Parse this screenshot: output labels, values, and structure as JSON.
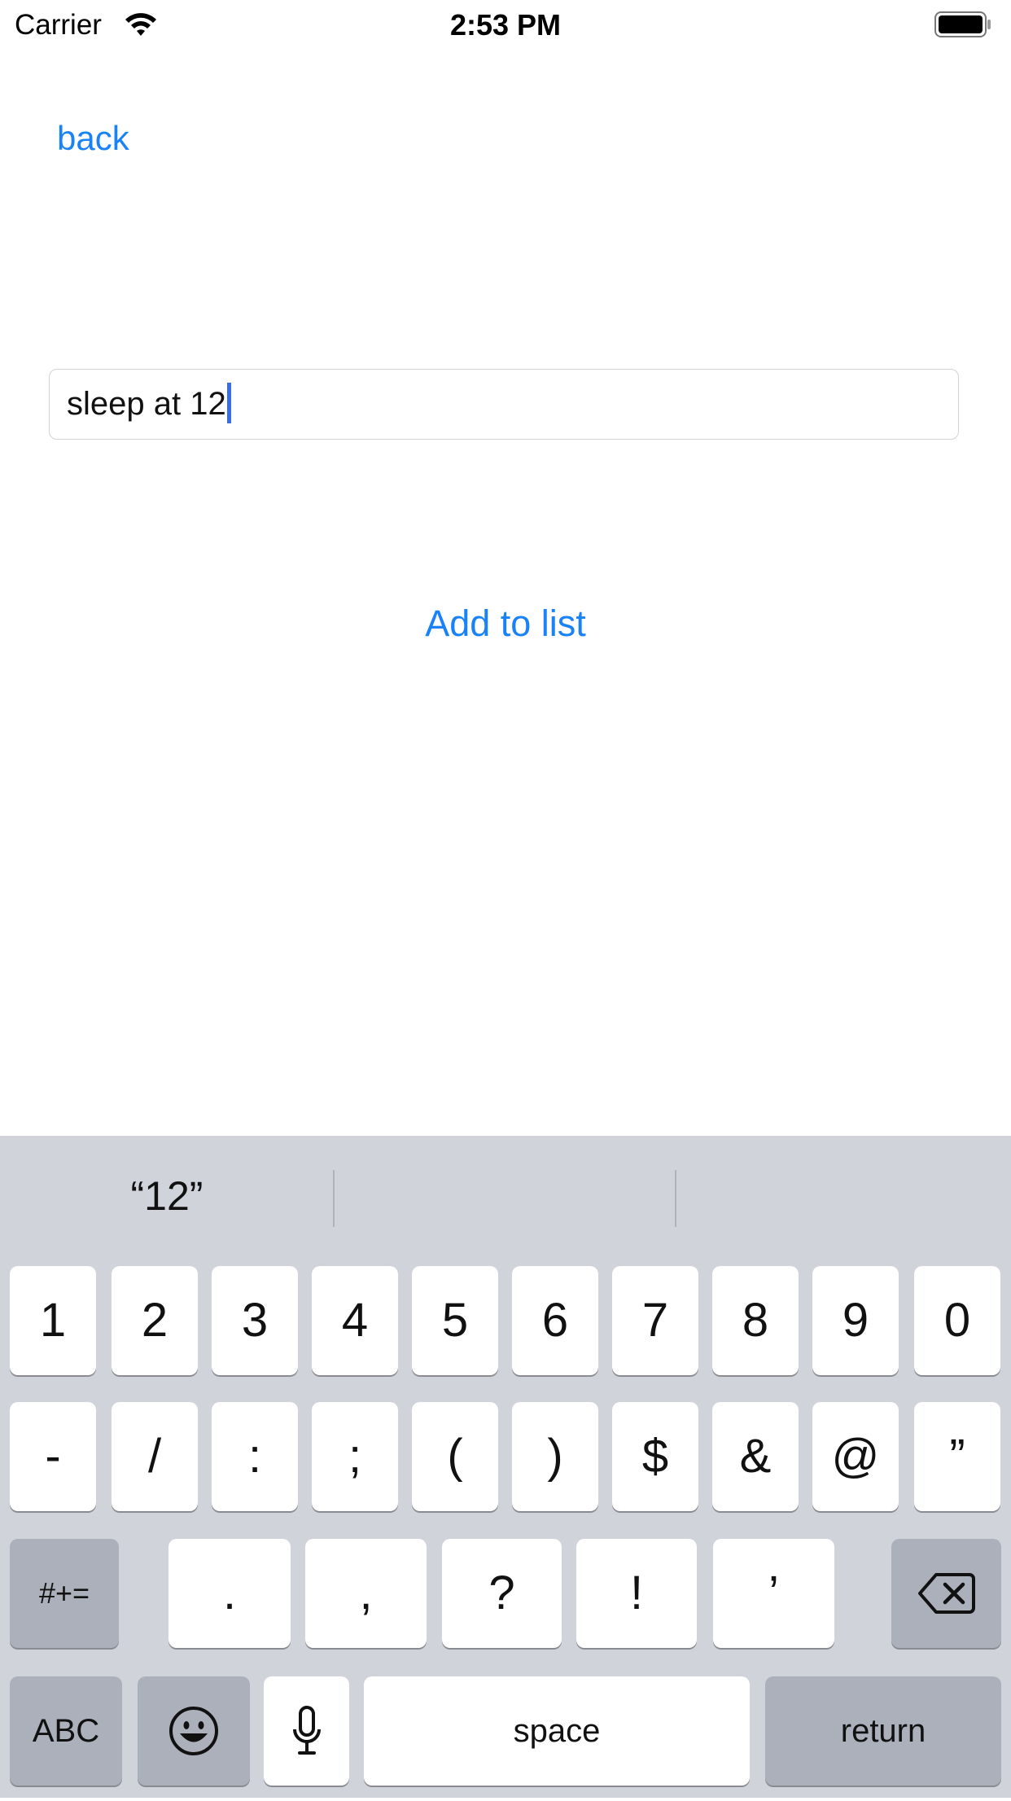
{
  "status_bar": {
    "carrier": "Carrier",
    "time": "2:53 PM",
    "wifi_icon": "wifi-icon",
    "battery_icon": "battery-icon"
  },
  "nav": {
    "back_label": "back"
  },
  "form": {
    "field_value": "sleep at 12",
    "add_button_label": "Add to list"
  },
  "colors": {
    "accent": "#1a82f7",
    "caret": "#3a6ee8",
    "keyboard_bg": "#d0d3da",
    "key_bg": "#ffffff",
    "special_key_bg": "#abb0bb"
  },
  "keyboard": {
    "suggestions": [
      "“12”",
      "",
      ""
    ],
    "row1": [
      "1",
      "2",
      "3",
      "4",
      "5",
      "6",
      "7",
      "8",
      "9",
      "0"
    ],
    "row2": [
      "-",
      "/",
      ":",
      ";",
      "(",
      ")",
      "$",
      "&",
      "@",
      "”"
    ],
    "row3": {
      "symbols_toggle": "#+=",
      "keys": [
        ".",
        ",",
        "?",
        "!",
        "’"
      ],
      "delete_icon": "delete-backspace-icon"
    },
    "row4": {
      "abc": "ABC",
      "emoji_icon": "emoji-icon",
      "mic_icon": "microphone-icon",
      "space": "space",
      "return": "return"
    }
  }
}
